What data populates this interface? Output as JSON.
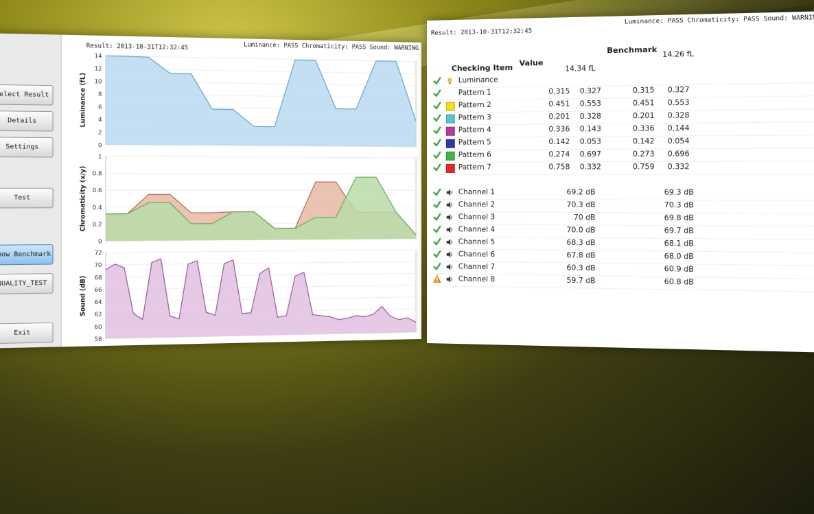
{
  "left": {
    "result": "Result: 2013-10-31T12:32:45",
    "status": "Luminance: PASS Chromaticity: PASS Sound: WARNING",
    "buttons": [
      "Select Result",
      "Details",
      "Settings",
      "Test",
      "Show Benchmark",
      "QUALITY_TEST",
      "Exit"
    ],
    "active_button": "Show Benchmark"
  },
  "right": {
    "result": "Result: 2013-10-31T12:32:45",
    "status": "Luminance: PASS Chromaticity: PASS Sound: WARNING",
    "headers": {
      "item": "Checking Item",
      "value": "Value",
      "bench": "Benchmark"
    },
    "luminance": {
      "name": "Luminance",
      "value": "14.34 fL",
      "bench": "14.26 fL"
    },
    "patterns": [
      {
        "name": "Pattern 1",
        "color": "#ffffff",
        "v": [
          "0.315",
          "0.327"
        ],
        "b": [
          "0.315",
          "0.327"
        ]
      },
      {
        "name": "Pattern 2",
        "color": "#f1de1e",
        "v": [
          "0.451",
          "0.553"
        ],
        "b": [
          "0.451",
          "0.553"
        ]
      },
      {
        "name": "Pattern 3",
        "color": "#54c4d6",
        "v": [
          "0.201",
          "0.328"
        ],
        "b": [
          "0.201",
          "0.328"
        ]
      },
      {
        "name": "Pattern 4",
        "color": "#b13ca3",
        "v": [
          "0.336",
          "0.143"
        ],
        "b": [
          "0.336",
          "0.144"
        ]
      },
      {
        "name": "Pattern 5",
        "color": "#2d39a8",
        "v": [
          "0.142",
          "0.053"
        ],
        "b": [
          "0.142",
          "0.054"
        ]
      },
      {
        "name": "Pattern 6",
        "color": "#46b04a",
        "v": [
          "0.274",
          "0.697"
        ],
        "b": [
          "0.273",
          "0.696"
        ]
      },
      {
        "name": "Pattern 7",
        "color": "#e02a2a",
        "v": [
          "0.758",
          "0.332"
        ],
        "b": [
          "0.759",
          "0.332"
        ]
      }
    ],
    "channels": [
      {
        "name": "Channel 1",
        "v": "69.2 dB",
        "b": "69.3 dB",
        "status": "pass"
      },
      {
        "name": "Channel 2",
        "v": "70.3 dB",
        "b": "70.3 dB",
        "status": "pass"
      },
      {
        "name": "Channel 3",
        "v": "70 dB",
        "b": "69.8 dB",
        "status": "pass"
      },
      {
        "name": "Channel 4",
        "v": "70.0 dB",
        "b": "69.7 dB",
        "status": "pass"
      },
      {
        "name": "Channel 5",
        "v": "68.3 dB",
        "b": "68.1 dB",
        "status": "pass"
      },
      {
        "name": "Channel 6",
        "v": "67.8 dB",
        "b": "68.0 dB",
        "status": "pass"
      },
      {
        "name": "Channel 7",
        "v": "60.3 dB",
        "b": "60.9 dB",
        "status": "pass"
      },
      {
        "name": "Channel 8",
        "v": "59.7 dB",
        "b": "60.8 dB",
        "status": "warning"
      }
    ]
  },
  "chart_data": [
    {
      "type": "area",
      "ylabel": "Luminance (fL)",
      "ylim": [
        0,
        14
      ],
      "yticks": [
        "0",
        "2",
        "4",
        "6",
        "8",
        "10",
        "12",
        "14"
      ],
      "series": [
        {
          "values": [
            14.5,
            14.8,
            13.9,
            11.4,
            11.4,
            5.8,
            5.8,
            3.1,
            3.1,
            13.9,
            13.9,
            6.1,
            6.1,
            17.5,
            17.5,
            4.2
          ]
        }
      ]
    },
    {
      "type": "area",
      "ylabel": "Chromaticity (x/y)",
      "ylim": [
        0,
        1
      ],
      "yticks": [
        "0",
        "0.2",
        "0.4",
        "0.6",
        "0.8",
        "1"
      ],
      "series": [
        {
          "values": [
            0.32,
            0.32,
            0.55,
            0.55,
            0.33,
            0.33,
            0.34,
            0.34,
            0.14,
            0.14,
            0.7,
            0.7,
            0.33,
            0.33,
            0.33,
            0.05
          ]
        },
        {
          "values": [
            0.32,
            0.32,
            0.45,
            0.45,
            0.2,
            0.2,
            0.34,
            0.34,
            0.14,
            0.14,
            0.27,
            0.27,
            0.76,
            0.76,
            0.33,
            0.05
          ]
        }
      ]
    },
    {
      "type": "area",
      "ylabel": "Sound (dB)",
      "ylim": [
        58,
        72
      ],
      "yticks": [
        "58",
        "60",
        "62",
        "64",
        "66",
        "68",
        "70",
        "72"
      ],
      "series": [
        {
          "values": [
            69.2,
            70.1,
            69.5,
            62,
            61,
            70.3,
            70.9,
            61.5,
            61,
            70,
            70.5,
            62,
            61.5,
            70.0,
            70.6,
            61.7,
            61.8,
            68.3,
            69.2,
            61,
            61.2,
            67.8,
            68.4,
            61.3,
            61.1,
            60.9,
            60.4,
            60.6,
            61,
            60.8,
            61.2,
            62.5,
            60.8,
            60.2,
            60.5,
            59.7
          ]
        }
      ]
    }
  ]
}
